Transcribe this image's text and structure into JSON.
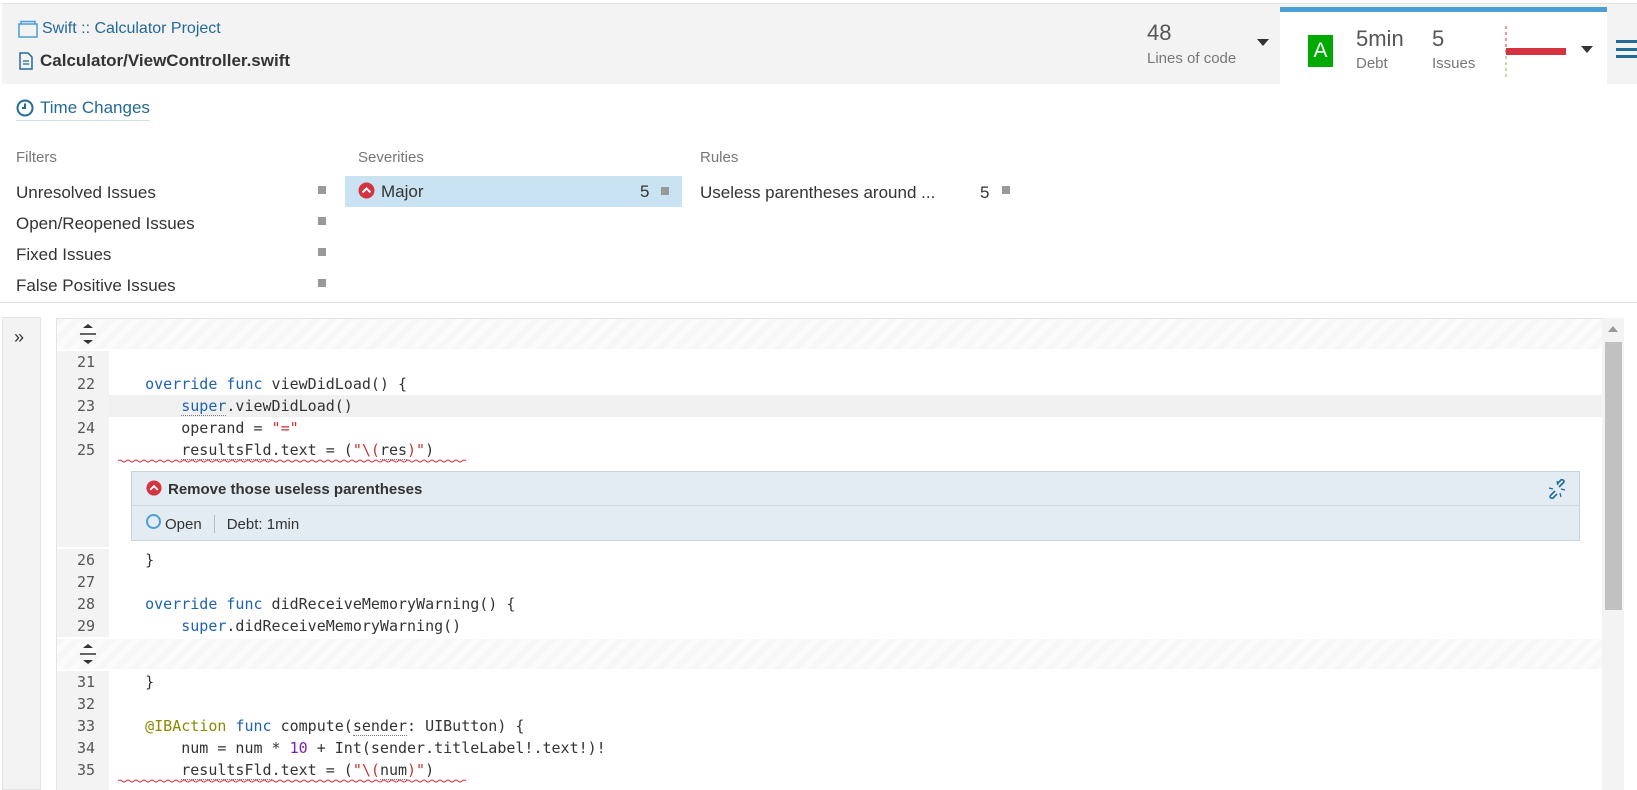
{
  "header": {
    "breadcrumb": "Swift :: Calculator Project",
    "file": "Calculator/ViewController.swift",
    "lines_of_code": {
      "value": "48",
      "label": "Lines of code"
    },
    "measures": {
      "rating": "A",
      "debt": "5min",
      "debt_label": "Debt",
      "issues": "5",
      "issues_label": "Issues",
      "accent_color": "#4b9fd5",
      "rating_color": "#00aa00",
      "issues_bar_color": "#d4333f"
    }
  },
  "time_changes": "Time Changes",
  "facets": {
    "filters": {
      "title": "Filters",
      "items": [
        "Unresolved Issues",
        "Open/Reopened Issues",
        "Fixed Issues",
        "False Positive Issues"
      ]
    },
    "severities": {
      "title": "Severities",
      "items": [
        {
          "label": "Major",
          "count": "5",
          "selected": true
        }
      ]
    },
    "rules": {
      "title": "Rules",
      "items": [
        {
          "label": "Useless parentheses around ...",
          "count": "5"
        }
      ]
    }
  },
  "source": {
    "lines": [
      {
        "n": "21",
        "code": ""
      },
      {
        "n": "22",
        "code": "    override func viewDidLoad() {"
      },
      {
        "n": "23",
        "code": "        super.viewDidLoad()"
      },
      {
        "n": "24",
        "code": "        operand = \"=\""
      },
      {
        "n": "25",
        "code": "        resultsFld.text = (\"\\(res)\")"
      },
      {
        "n": "26",
        "code": "    }"
      },
      {
        "n": "27",
        "code": ""
      },
      {
        "n": "28",
        "code": "    override func didReceiveMemoryWarning() {"
      },
      {
        "n": "29",
        "code": "        super.didReceiveMemoryWarning()"
      },
      {
        "n": "31",
        "code": "    }"
      },
      {
        "n": "32",
        "code": ""
      },
      {
        "n": "33",
        "code": "    @IBAction func compute(sender: UIButton) {"
      },
      {
        "n": "34",
        "code": "        num = num * 10 + Int(sender.titleLabel!.text!)!"
      },
      {
        "n": "35",
        "code": "        resultsFld.text = (\"\\(num)\")"
      }
    ],
    "issue": {
      "message": "Remove those useless parentheses",
      "status": "Open",
      "debt": "Debt: 1min",
      "severity_color": "#d4333f"
    }
  }
}
